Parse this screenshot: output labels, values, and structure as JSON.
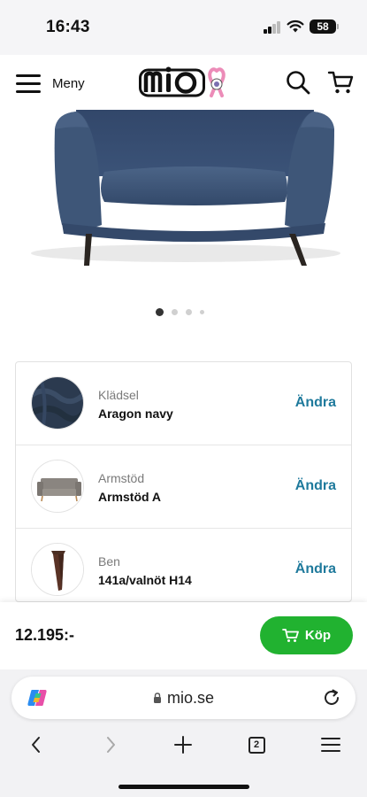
{
  "status_bar": {
    "time": "16:43",
    "battery": "58"
  },
  "header": {
    "menu_label": "Meny",
    "logo_text": "mio"
  },
  "carousel": {
    "total": 4,
    "active": 1
  },
  "options": [
    {
      "label": "Klädsel",
      "value": "Aragon navy",
      "action": "Ändra",
      "thumb_icon": "fabric-swatch-icon"
    },
    {
      "label": "Armstöd",
      "value": "Armstöd A",
      "action": "Ändra",
      "thumb_icon": "sofa-thumbnail-icon"
    },
    {
      "label": "Ben",
      "value": "141a/valnöt H14",
      "action": "Ändra",
      "thumb_icon": "leg-thumbnail-icon"
    }
  ],
  "buy_bar": {
    "price": "12.195:-",
    "buy_label": "Köp"
  },
  "browser": {
    "url": "mio.se",
    "tab_count": "2"
  },
  "colors": {
    "accent_green": "#21b230",
    "link_blue": "#1f7a9c",
    "sofa_navy": "#3e5678"
  }
}
